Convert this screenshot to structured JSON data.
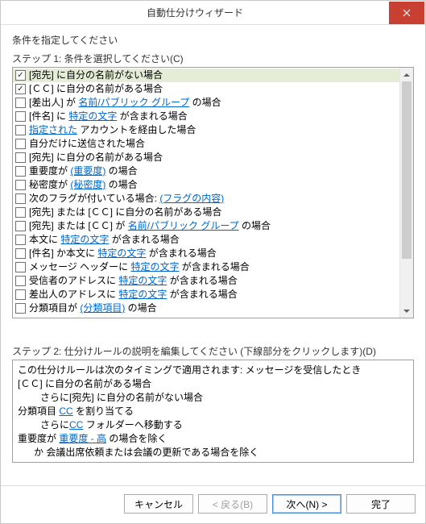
{
  "window": {
    "title": "自動仕分けウィザード"
  },
  "instruction": "条件を指定してください",
  "step1": {
    "label": "ステップ 1: 条件を選択してください(C)",
    "items": [
      {
        "checked": true,
        "selected": true,
        "parts": [
          {
            "t": "[宛先] に自分の名前がない場合"
          }
        ]
      },
      {
        "checked": true,
        "selected": false,
        "parts": [
          {
            "t": "[ＣＣ] に自分の名前がある場合"
          }
        ]
      },
      {
        "checked": false,
        "selected": false,
        "parts": [
          {
            "t": "[差出人] が "
          },
          {
            "t": "名前/パブリック グループ",
            "link": true
          },
          {
            "t": " の場合"
          }
        ]
      },
      {
        "checked": false,
        "selected": false,
        "parts": [
          {
            "t": "[件名] に "
          },
          {
            "t": "特定の文字",
            "link": true
          },
          {
            "t": " が含まれる場合"
          }
        ]
      },
      {
        "checked": false,
        "selected": false,
        "parts": [
          {
            "t": "指定された",
            "link": true
          },
          {
            "t": " アカウントを経由した場合"
          }
        ]
      },
      {
        "checked": false,
        "selected": false,
        "parts": [
          {
            "t": "自分だけに送信された場合"
          }
        ]
      },
      {
        "checked": false,
        "selected": false,
        "parts": [
          {
            "t": "[宛先] に自分の名前がある場合"
          }
        ]
      },
      {
        "checked": false,
        "selected": false,
        "parts": [
          {
            "t": "重要度が "
          },
          {
            "t": "(重要度)",
            "link": true
          },
          {
            "t": " の場合"
          }
        ]
      },
      {
        "checked": false,
        "selected": false,
        "parts": [
          {
            "t": "秘密度が "
          },
          {
            "t": "(秘密度)",
            "link": true
          },
          {
            "t": " の場合"
          }
        ]
      },
      {
        "checked": false,
        "selected": false,
        "parts": [
          {
            "t": "次のフラグが付いている場合: "
          },
          {
            "t": "(フラグの内容)",
            "link": true
          }
        ]
      },
      {
        "checked": false,
        "selected": false,
        "parts": [
          {
            "t": "[宛先] または [ＣＣ] に自分の名前がある場合"
          }
        ]
      },
      {
        "checked": false,
        "selected": false,
        "parts": [
          {
            "t": "[宛先] または [ＣＣ] が "
          },
          {
            "t": "名前/パブリック グループ",
            "link": true
          },
          {
            "t": " の場合"
          }
        ]
      },
      {
        "checked": false,
        "selected": false,
        "parts": [
          {
            "t": "本文に "
          },
          {
            "t": "特定の文字",
            "link": true
          },
          {
            "t": " が含まれる場合"
          }
        ]
      },
      {
        "checked": false,
        "selected": false,
        "parts": [
          {
            "t": "[件名] か本文に "
          },
          {
            "t": "特定の文字",
            "link": true
          },
          {
            "t": " が含まれる場合"
          }
        ]
      },
      {
        "checked": false,
        "selected": false,
        "parts": [
          {
            "t": "メッセージ ヘッダーに "
          },
          {
            "t": "特定の文字",
            "link": true
          },
          {
            "t": " が含まれる場合"
          }
        ]
      },
      {
        "checked": false,
        "selected": false,
        "parts": [
          {
            "t": "受信者のアドレスに "
          },
          {
            "t": "特定の文字",
            "link": true
          },
          {
            "t": " が含まれる場合"
          }
        ]
      },
      {
        "checked": false,
        "selected": false,
        "parts": [
          {
            "t": "差出人のアドレスに "
          },
          {
            "t": "特定の文字",
            "link": true
          },
          {
            "t": " が含まれる場合"
          }
        ]
      },
      {
        "checked": false,
        "selected": false,
        "parts": [
          {
            "t": "分類項目が "
          },
          {
            "t": "(分類項目)",
            "link": true
          },
          {
            "t": " の場合"
          }
        ]
      }
    ]
  },
  "step2": {
    "label": "ステップ 2: 仕分けルールの説明を編集してください (下線部分をクリックします)(D)",
    "lines": [
      {
        "cls": "",
        "parts": [
          {
            "t": "この仕分けルールは次のタイミングで適用されます: メッセージを受信したとき"
          }
        ]
      },
      {
        "cls": "",
        "parts": [
          {
            "t": "[ＣＣ] に自分の名前がある場合"
          }
        ]
      },
      {
        "cls": "indent1",
        "parts": [
          {
            "t": "さらに[宛先] に自分の名前がない場合"
          }
        ]
      },
      {
        "cls": "",
        "parts": [
          {
            "t": "分類項目 "
          },
          {
            "t": "CC",
            "link": true
          },
          {
            "t": " を割り当てる"
          }
        ]
      },
      {
        "cls": "indent1",
        "parts": [
          {
            "t": "さらに"
          },
          {
            "t": "CC",
            "link": true
          },
          {
            "t": " フォルダーへ移動する"
          }
        ]
      },
      {
        "cls": "",
        "parts": [
          {
            "t": "重要度が "
          },
          {
            "t": "重要度 - 高",
            "link": true
          },
          {
            "t": " の場合を除く"
          }
        ]
      },
      {
        "cls": "indent-s",
        "parts": [
          {
            "t": "か 会議出席依頼または会議の更新である場合を除く"
          }
        ]
      }
    ]
  },
  "footer": {
    "cancel": "キャンセル",
    "back": "< 戻る(B)",
    "next": "次へ(N) >",
    "finish": "完了"
  }
}
